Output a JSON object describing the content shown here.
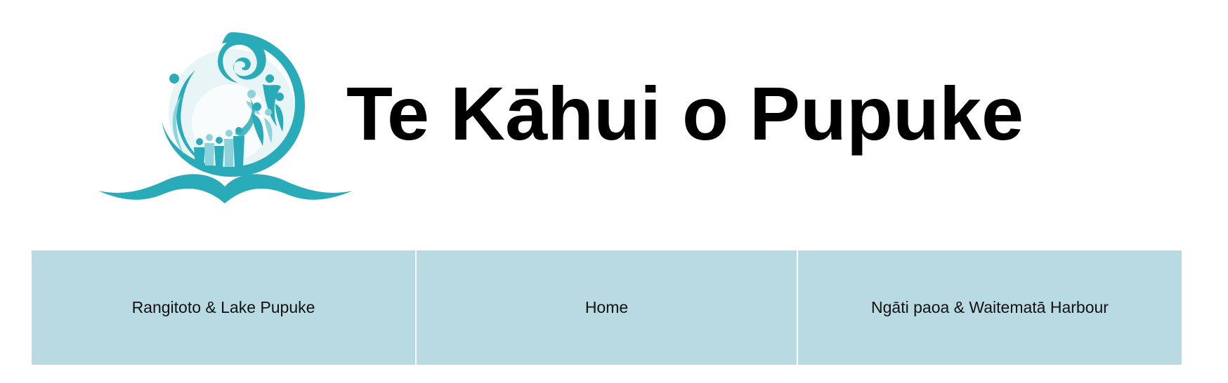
{
  "header": {
    "logo_icon": "koru-book-logo-icon",
    "title": "Te Kāhui o Pupuke"
  },
  "nav": {
    "items": [
      {
        "label": "Rangitoto & Lake Pupuke"
      },
      {
        "label": "Home"
      },
      {
        "label": "Ngāti paoa & Waitematā Harbour"
      }
    ]
  },
  "colors": {
    "brand_teal": "#2aabb9",
    "light_teal": "#8fd3da",
    "nav_background": "#b8dae2",
    "title_text": "#000000"
  }
}
